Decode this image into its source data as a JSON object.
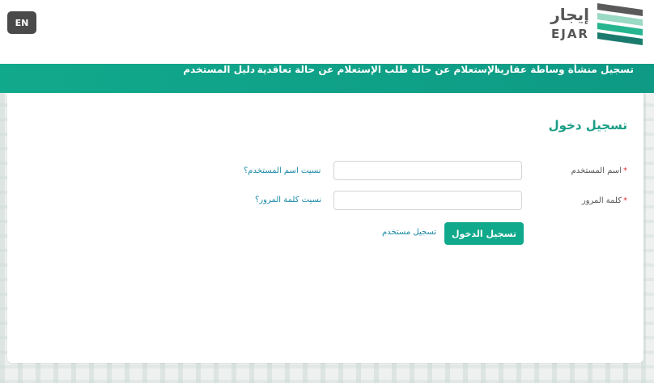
{
  "header": {
    "lang_button": "EN",
    "logo_ar": "إيجار",
    "logo_en": "EJAR"
  },
  "nav": {
    "items": [
      {
        "label": "تسجيل منشأة وساطة عقارية"
      },
      {
        "label": "الإستعلام عن حالة طلب"
      },
      {
        "label": "الإستعلام عن حالة تعاقدية"
      },
      {
        "label": "دليل المستخدم"
      }
    ]
  },
  "login": {
    "title": "تسجيل دخول",
    "username_label": "اسم المستخدم",
    "password_label": "كلمة المرور",
    "required_mark": "*",
    "username_value": "",
    "password_value": "",
    "forgot_username": "نسيت اسم المستخدم؟",
    "forgot_password": "نسيت كلمة المرور؟",
    "submit_label": "تسجيل الدخول",
    "register_label": "تسجيل مستخدم"
  },
  "colors": {
    "brand": "#11a98c",
    "link": "#1b8aa8",
    "required": "#e0332b"
  }
}
